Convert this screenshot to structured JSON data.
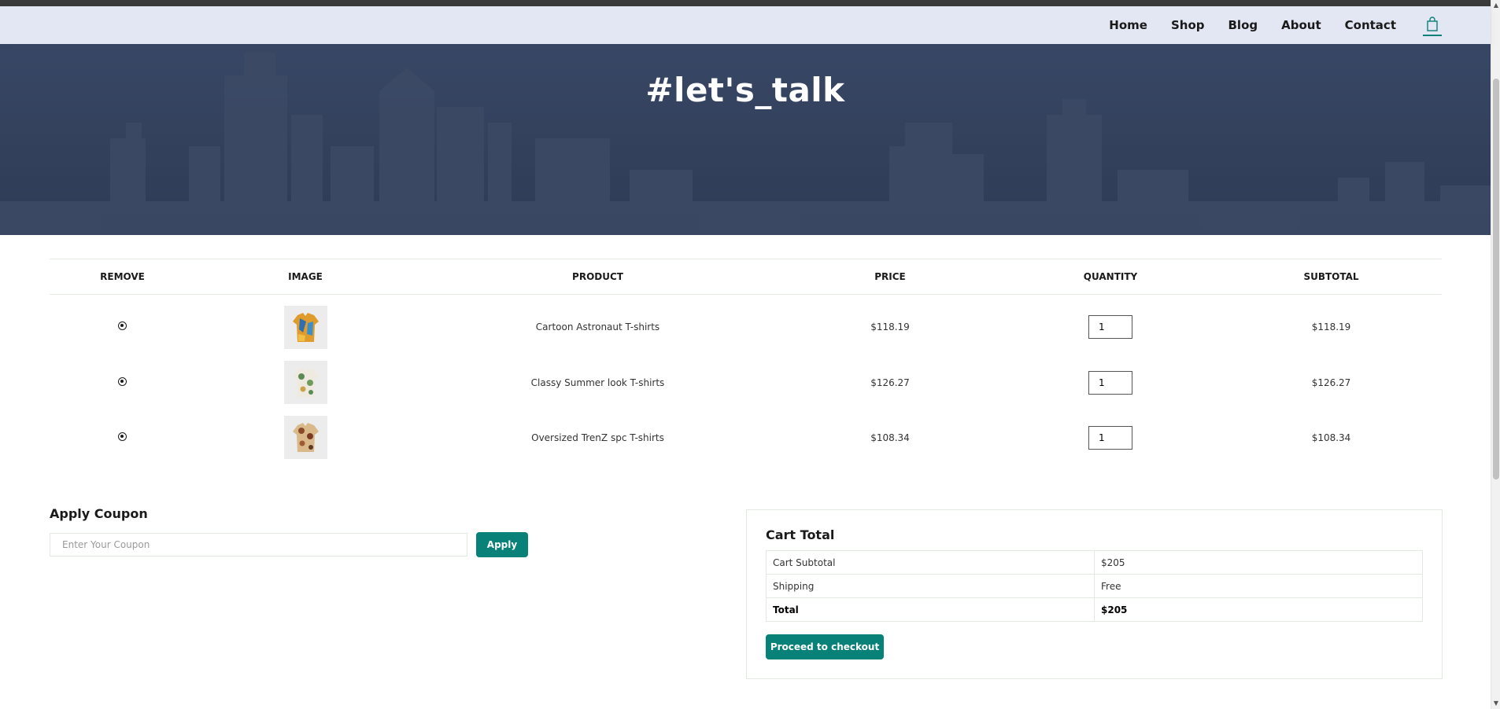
{
  "nav": {
    "items": [
      "Home",
      "Shop",
      "Blog",
      "About",
      "Contact"
    ],
    "cart_icon": "shopping-bag-icon",
    "active": "cart"
  },
  "hero": {
    "title": "#let's_talk"
  },
  "cart_table": {
    "headers": [
      "REMOVE",
      "IMAGE",
      "PRODUCT",
      "PRICE",
      "QUANTITY",
      "SUBTOTAL"
    ],
    "rows": [
      {
        "product": "Cartoon Astronaut T-shirts",
        "price": "$118.19",
        "quantity": "1",
        "subtotal": "$118.19",
        "image": "shirt-image-astronaut"
      },
      {
        "product": "Classy Summer look T-shirts",
        "price": "$126.27",
        "quantity": "1",
        "subtotal": "$126.27",
        "image": "shirt-image-floral"
      },
      {
        "product": "Oversized TrenZ spc T-shirts",
        "price": "$108.34",
        "quantity": "1",
        "subtotal": "$108.34",
        "image": "shirt-image-print"
      }
    ]
  },
  "coupon": {
    "title": "Apply Coupon",
    "placeholder": "Enter Your Coupon",
    "button": "Apply"
  },
  "totals": {
    "title": "Cart Total",
    "rows": [
      {
        "label": "Cart Subtotal",
        "value": "$205"
      },
      {
        "label": "Shipping",
        "value": "Free"
      },
      {
        "label": "Total",
        "value": "$205"
      }
    ],
    "button": "Proceed to checkout"
  },
  "colors": {
    "accent": "#088178",
    "navbar": "#e3e6f3",
    "hero": "#2e3b55"
  }
}
